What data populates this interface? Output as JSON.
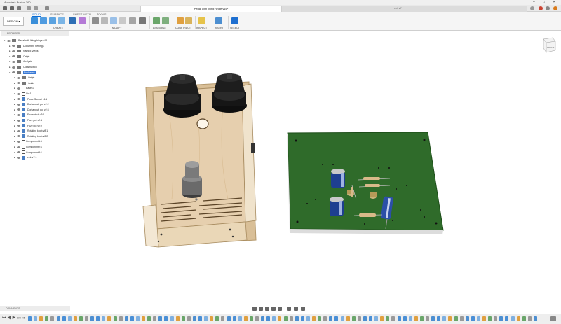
{
  "window": {
    "title": "Autodesk Fusion 360"
  },
  "tabs": {
    "active": "Pedal with living hinge v16*",
    "other": "ext v7"
  },
  "ribbon": {
    "design_label": "DESIGN",
    "tabs": [
      "SOLID",
      "SURFACE",
      "SHEET METAL",
      "TOOLS"
    ],
    "active_tab": "SOLID",
    "groups": [
      "CREATE",
      "MODIFY",
      "ASSEMBLE",
      "CONSTRUCT",
      "INSPECT",
      "INSERT",
      "SELECT"
    ]
  },
  "browser": {
    "header": "BROWSER",
    "items": [
      {
        "label": "Pedal with living hinge v16",
        "indent": 0,
        "type": "root"
      },
      {
        "label": "Document Settings",
        "indent": 1,
        "type": "folder"
      },
      {
        "label": "Named Views",
        "indent": 1,
        "type": "folder"
      },
      {
        "label": "Origin",
        "indent": 1,
        "type": "folder"
      },
      {
        "label": "Analysis",
        "indent": 1,
        "type": "folder"
      },
      {
        "label": "Construction",
        "indent": 1,
        "type": "folder"
      },
      {
        "label": "Enclosure",
        "indent": 1,
        "type": "folder",
        "selected": true
      },
      {
        "label": "Origin",
        "indent": 2,
        "type": "folder"
      },
      {
        "label": "Joints",
        "indent": 2,
        "type": "folder"
      },
      {
        "label": "Base 1",
        "indent": 2,
        "type": "comp"
      },
      {
        "label": "Lid:1",
        "indent": 2,
        "type": "comp"
      },
      {
        "label": "PowerSocket v4:1",
        "indent": 2,
        "type": "link"
      },
      {
        "label": "Dorkaboutt pot v2:2",
        "indent": 2,
        "type": "link"
      },
      {
        "label": "Dorkaboutt pot v2:3",
        "indent": 2,
        "type": "link"
      },
      {
        "label": "Footswitch v3:1",
        "indent": 2,
        "type": "link"
      },
      {
        "label": "Fuzz pot v2:1",
        "indent": 2,
        "type": "link"
      },
      {
        "label": "Fuzz pot v2:2",
        "indent": 2,
        "type": "link"
      },
      {
        "label": "Rotating knob v8:1",
        "indent": 2,
        "type": "link"
      },
      {
        "label": "Rotating knob v8:2",
        "indent": 2,
        "type": "link"
      },
      {
        "label": "Component1:1",
        "indent": 2,
        "type": "comp"
      },
      {
        "label": "Component2:1",
        "indent": 2,
        "type": "comp"
      },
      {
        "label": "Component3:1",
        "indent": 2,
        "type": "comp"
      },
      {
        "label": "ectr v7:1",
        "indent": 2,
        "type": "link"
      }
    ]
  },
  "comments": {
    "label": "COMMENTS"
  },
  "viewcube": {
    "label": "FRONT"
  },
  "colors": {
    "accent": "#0a6cd6",
    "pcb": "#2f6b2a",
    "wood": "#e2c9a4",
    "knob": "#1b1b1b"
  }
}
